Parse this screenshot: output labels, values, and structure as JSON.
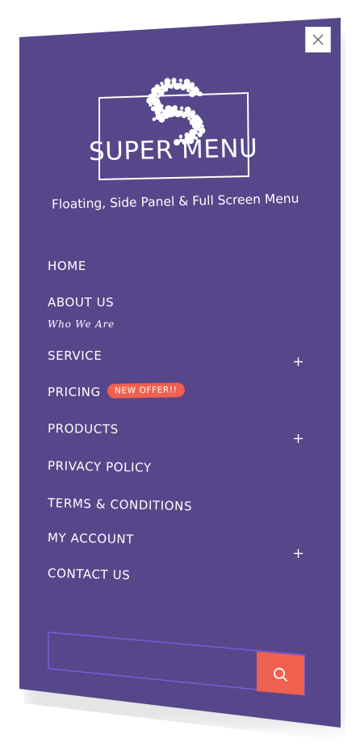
{
  "logo": {
    "text": "SUPER MENU",
    "tagline": "Floating, Side Panel & Full Screen Menu"
  },
  "menu": {
    "items": [
      {
        "label": "HOME"
      },
      {
        "label": "ABOUT US",
        "sub_label": "Who We Are"
      },
      {
        "label": "SERVICE"
      },
      {
        "label": "PRICING",
        "badge": "NEW OFFER!!"
      },
      {
        "label": "PRODUCTS"
      },
      {
        "label": "PRIVACY POLICY"
      },
      {
        "label": "TERMS & CONDITIONS"
      },
      {
        "label": "MY ACCOUNT"
      },
      {
        "label": "CONTACT US"
      }
    ]
  },
  "search": {
    "placeholder": "",
    "value": ""
  },
  "icons": {
    "close": "close-icon",
    "expand": "plus-icon",
    "search": "search-icon"
  },
  "colors": {
    "panel": "#56478a",
    "accent": "#f0604f",
    "search_border": "#7b5ce0",
    "text": "#ffffff"
  }
}
